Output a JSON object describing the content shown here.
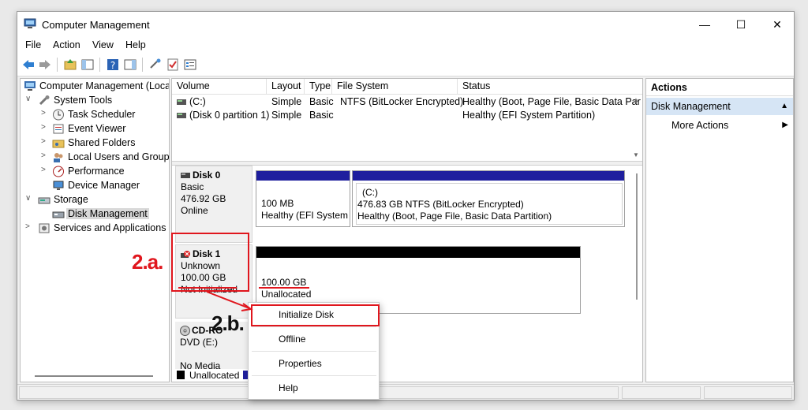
{
  "window": {
    "title": "Computer Management",
    "controls": {
      "minimize": "—",
      "maximize": "☐",
      "close": "✕"
    }
  },
  "menu": [
    "File",
    "Action",
    "View",
    "Help"
  ],
  "tree": {
    "root": "Computer Management (Local",
    "items": [
      {
        "label": "System Tools",
        "chevron": "∨",
        "level": 1
      },
      {
        "label": "Task Scheduler",
        "chevron": ">",
        "level": 2
      },
      {
        "label": "Event Viewer",
        "chevron": ">",
        "level": 2
      },
      {
        "label": "Shared Folders",
        "chevron": ">",
        "level": 2
      },
      {
        "label": "Local Users and Groups",
        "chevron": ">",
        "level": 2
      },
      {
        "label": "Performance",
        "chevron": ">",
        "level": 2
      },
      {
        "label": "Device Manager",
        "chevron": "",
        "level": 2
      },
      {
        "label": "Storage",
        "chevron": "∨",
        "level": 1
      },
      {
        "label": "Disk Management",
        "chevron": "",
        "level": 2,
        "selected": true
      },
      {
        "label": "Services and Applications",
        "chevron": ">",
        "level": 1
      }
    ]
  },
  "volumes": {
    "headers": [
      "Volume",
      "Layout",
      "Type",
      "File System",
      "Status"
    ],
    "rows": [
      [
        "(C:)",
        "Simple",
        "Basic",
        "NTFS (BitLocker Encrypted)",
        "Healthy (Boot, Page File, Basic Data Partitio"
      ],
      [
        "(Disk 0 partition 1)",
        "Simple",
        "Basic",
        "",
        "Healthy (EFI System Partition)"
      ]
    ]
  },
  "disks": {
    "disk0": {
      "name": "Disk 0",
      "type": "Basic",
      "size": "476.92 GB",
      "status": "Online",
      "partitions": [
        {
          "size": "100 MB",
          "status": "Healthy (EFI System"
        },
        {
          "name": "(C:)",
          "size": "476.83 GB NTFS (BitLocker Encrypted)",
          "status": "Healthy (Boot, Page File, Basic Data Partition)"
        }
      ]
    },
    "disk1": {
      "prefix": "*",
      "name": "Disk 1",
      "type": "Unknown",
      "size": "100.00 GB",
      "status": "Not Initialized",
      "partition": {
        "size": "100.00 GB",
        "status": "Unallocated"
      }
    },
    "cdrom": {
      "name": "CD-RO",
      "type": "DVD (E:)",
      "status": "No Media"
    },
    "legend": {
      "unallocated": "Unallocated"
    }
  },
  "actions": {
    "header": "Actions",
    "selected": "Disk Management",
    "more": "More Actions",
    "arrow_up": "▲",
    "arrow_right": "▶"
  },
  "context_menu": [
    "Initialize Disk",
    "Offline",
    "Properties",
    "Help"
  ],
  "annotations": {
    "a": "2.a.",
    "b": "2.b."
  },
  "colors": {
    "partition_bar": "#1f1f9e",
    "unallocated_bar": "#000000",
    "annotation": "#e0161d",
    "selection": "#d6e5f5"
  }
}
